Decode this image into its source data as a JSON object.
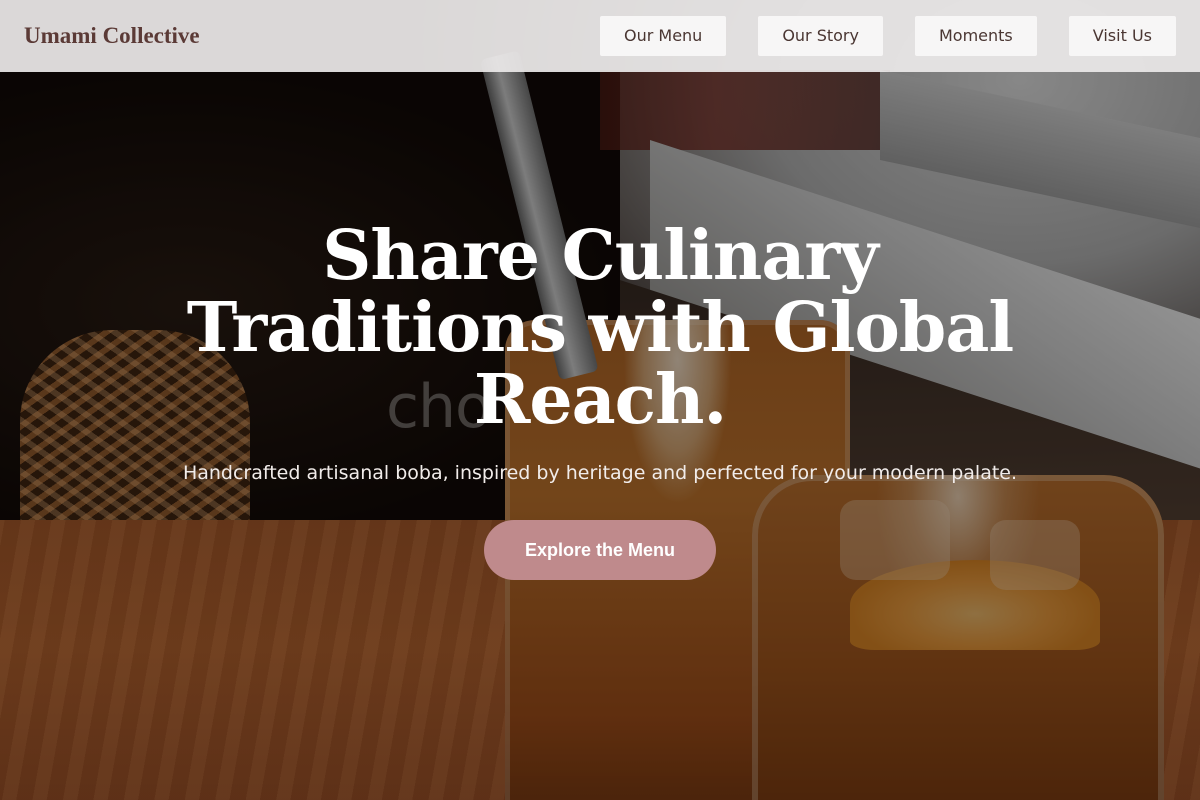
{
  "header": {
    "logo": "Umami Collective",
    "nav": [
      {
        "label": "Our Menu"
      },
      {
        "label": "Our Story"
      },
      {
        "label": "Moments"
      },
      {
        "label": "Visit Us"
      }
    ]
  },
  "hero": {
    "ghost_text": "cho",
    "title": "Share Culinary Traditions with Global Reach.",
    "subtitle": "Handcrafted artisanal boba, inspired by heritage and perfected for your modern palate.",
    "cta_label": "Explore the Menu"
  },
  "colors": {
    "logo": "#5b3a36",
    "header_bg": "#ebe9e9",
    "nav_button_bg": "#f7f6f6",
    "nav_text": "#4a3632",
    "cta_bg": "#bf8a8c",
    "title": "#ffffff"
  }
}
